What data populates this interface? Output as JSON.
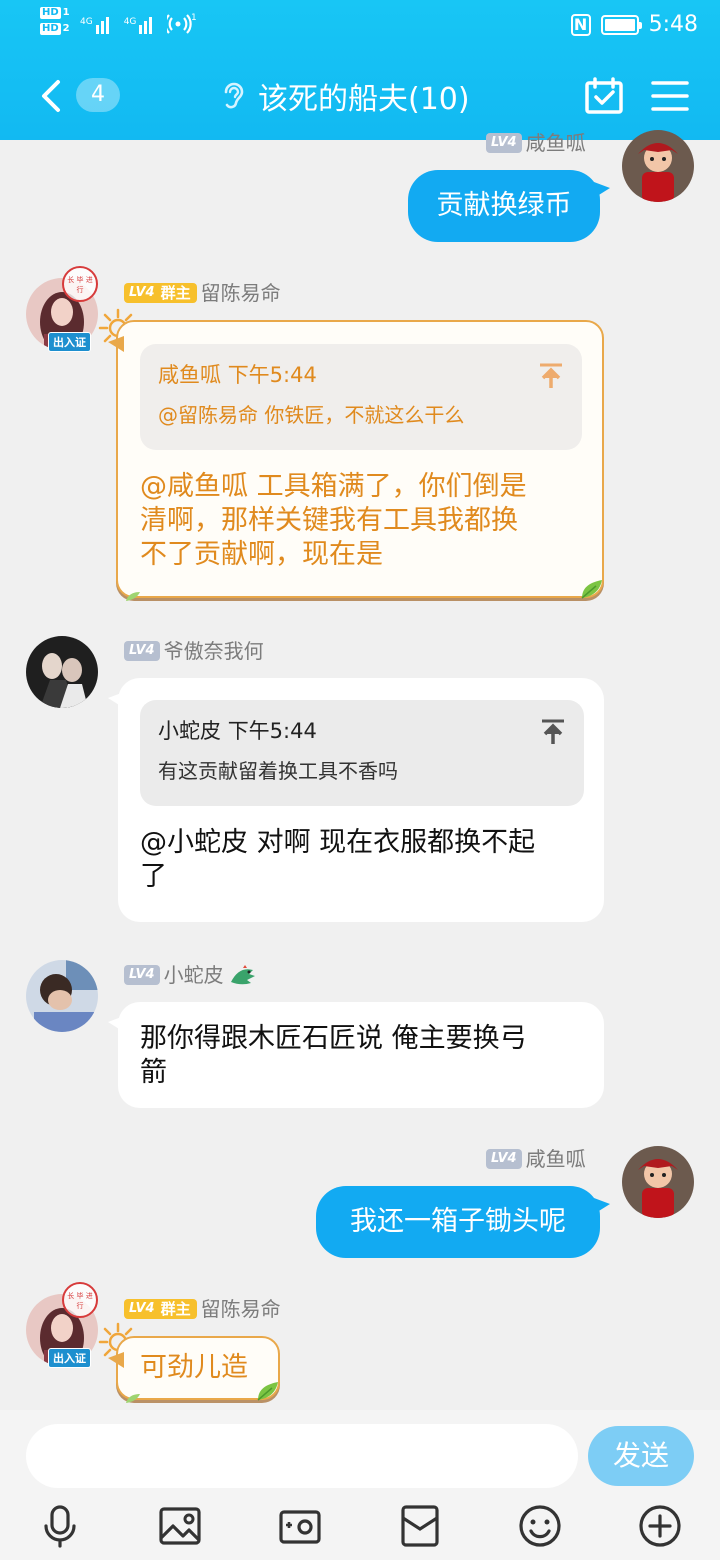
{
  "status_bar": {
    "hd1": "HD",
    "hd1_num": "1",
    "hd2": "HD",
    "hd2_num": "2",
    "net1": "4G",
    "net2": "4G",
    "hotspot_count": "1",
    "time": "5:48",
    "nfc": "N"
  },
  "header": {
    "unread_count": "4",
    "title": "该死的船夫(10)"
  },
  "messages": [
    {
      "side": "right",
      "level": "LV4",
      "nickname": "咸鱼呱",
      "text": "贡献换绿币"
    },
    {
      "side": "left",
      "level": "LV4",
      "role": "群主",
      "nickname": "留陈易命",
      "badge": "出入证",
      "stamp": "长 毕 进 行",
      "quote": {
        "name": "咸鱼呱",
        "time": "下午5:44",
        "text": "@留陈易命 你铁匠，不就这么干么"
      },
      "text_lines": [
        "@咸鱼呱 工具箱满了，你们倒是",
        "清啊，那样关键我有工具我都换",
        "不了贡献啊，现在是"
      ]
    },
    {
      "side": "left",
      "level": "LV4",
      "nickname": "爷傲奈我何",
      "quote": {
        "name": "小蛇皮",
        "time": "下午5:44",
        "text": "有这贡献留着换工具不香吗"
      },
      "text_lines": [
        "@小蛇皮 对啊 现在衣服都换不起",
        "了"
      ]
    },
    {
      "side": "left",
      "level": "LV4",
      "nickname": "小蛇皮",
      "text_lines": [
        "那你得跟木匠石匠说  俺主要换弓",
        "箭"
      ]
    },
    {
      "side": "right",
      "level": "LV4",
      "nickname": "咸鱼呱",
      "text": "我还一箱子锄头呢"
    },
    {
      "side": "left",
      "level": "LV4",
      "role": "群主",
      "nickname": "留陈易命",
      "badge": "出入证",
      "stamp": "长 毕 进 行",
      "text": "可劲儿造"
    }
  ],
  "input": {
    "placeholder": "",
    "send_label": "发送"
  },
  "colors": {
    "header_bg": "#12b9f2",
    "my_bubble": "#12aaf2",
    "gold_text": "#e08a1e",
    "owner_badge": "#f7c02c"
  },
  "toolbar": [
    "mic-icon",
    "image-icon",
    "camera-icon",
    "file-icon",
    "emoji-icon",
    "plus-icon"
  ]
}
